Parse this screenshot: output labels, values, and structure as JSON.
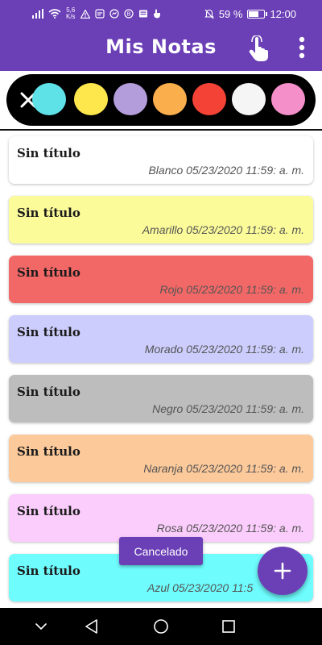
{
  "status_bar": {
    "speed_value": "5,6",
    "speed_unit": "K/s",
    "battery_percent": "59 %",
    "battery_level": 0.59,
    "time": "12:00"
  },
  "app_bar": {
    "title": "Mis Notas",
    "icons": [
      "touch-icon",
      "more-vert-icon"
    ]
  },
  "palette": {
    "close_icon": "close-icon",
    "colors": [
      "#5fe1e8",
      "#fde74c",
      "#b39ddb",
      "#fbae4c",
      "#f44336",
      "#f5f5f5",
      "#f48fc9"
    ]
  },
  "notes": [
    {
      "title": "Sin título",
      "meta": "Blanco 05/23/2020 11:59: a. m.",
      "bg": "#ffffff"
    },
    {
      "title": "Sin título",
      "meta": "Amarillo 05/23/2020 11:59: a. m.",
      "bg": "#fbfb9a"
    },
    {
      "title": "Sin título",
      "meta": "Rojo 05/23/2020 11:59: a. m.",
      "bg": "#f26866"
    },
    {
      "title": "Sin título",
      "meta": "Morado 05/23/2020 11:59: a. m.",
      "bg": "#cccdfc"
    },
    {
      "title": "Sin título",
      "meta": "Negro 05/23/2020 11:59: a. m.",
      "bg": "#bdbdbd"
    },
    {
      "title": "Sin título",
      "meta": "Naranja 05/23/2020 11:59: a. m.",
      "bg": "#fcc99a"
    },
    {
      "title": "Sin título",
      "meta": "Rosa 05/23/2020 11:59: a. m.",
      "bg": "#fbcdfc"
    },
    {
      "title": "Sin título",
      "meta": "Azul 05/23/2020 11:5",
      "bg": "#6efcfd"
    }
  ],
  "snackbar": {
    "text": "Cancelado"
  },
  "fab": {
    "icon": "add-icon"
  },
  "nav_bar": {
    "icons": [
      "hide-nav-icon",
      "back-icon",
      "home-icon",
      "recents-icon"
    ]
  },
  "colors": {
    "primary": "#6b3fb6"
  }
}
